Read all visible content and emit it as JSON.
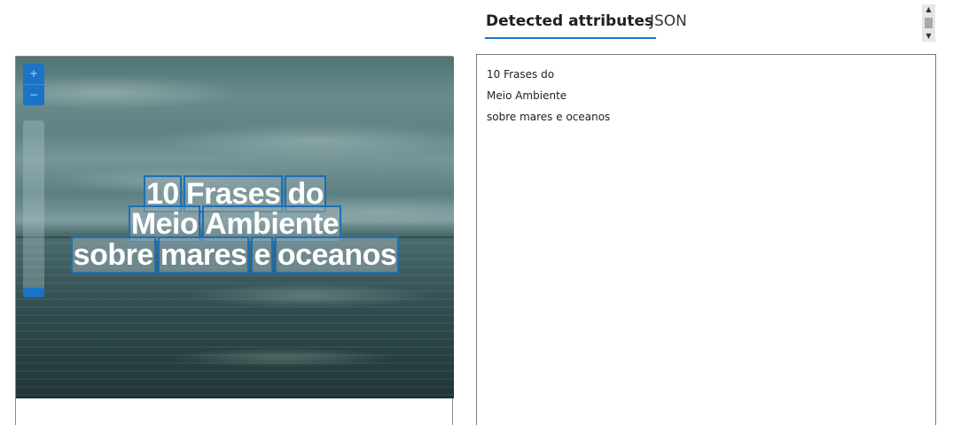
{
  "image_overlay": {
    "lines": [
      [
        "10",
        "Frases",
        "do"
      ],
      [
        "Meio",
        "Ambiente"
      ],
      [
        "sobre",
        "mares",
        "e",
        "oceanos"
      ]
    ]
  },
  "zoom": {
    "in_icon": "plus-icon",
    "out_icon": "minus-icon",
    "level": 0.0
  },
  "tabs": {
    "attributes": "Detected attributes",
    "json": "JSON",
    "active": "attributes"
  },
  "result": {
    "lines": [
      "10 Frases do",
      "Meio Ambiente",
      "sobre mares e oceanos"
    ]
  },
  "colors": {
    "accent": "#1a73c6",
    "box_border": "#1b6fb8"
  }
}
